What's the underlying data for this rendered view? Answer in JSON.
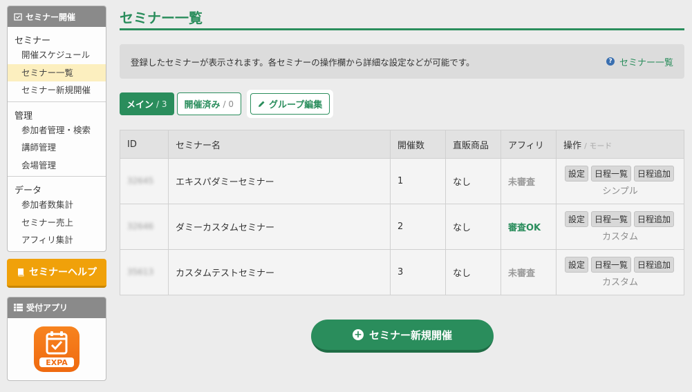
{
  "sidebar": {
    "header": "セミナー開催",
    "sections": [
      {
        "title": "セミナー",
        "items": [
          "開催スケジュール",
          "セミナー一覧",
          "セミナー新規開催"
        ]
      },
      {
        "title": "管理",
        "items": [
          "参加者管理・検索",
          "講師管理",
          "会場管理"
        ]
      },
      {
        "title": "データ",
        "items": [
          "参加者数集計",
          "セミナー売上",
          "アフィリ集計"
        ]
      }
    ],
    "help_label": "セミナーヘルプ",
    "app_header": "受付アプリ",
    "app_name": "EXPA"
  },
  "main": {
    "title": "セミナー一覧",
    "info_text": "登録したセミナーが表示されます。各セミナーの操作欄から詳細な設定などが可能です。",
    "info_link": "セミナー一覧",
    "tabs": [
      {
        "label": "メイン",
        "count": "/ 3"
      },
      {
        "label": "開催済み",
        "count": "/ 0"
      },
      {
        "label": "グループ編集",
        "count": ""
      }
    ],
    "table": {
      "headers": [
        "ID",
        "セミナー名",
        "開催数",
        "直販商品",
        "アフィリ",
        "操作"
      ],
      "ops_header_sub": "/ モード",
      "op_buttons": [
        "設定",
        "日程一覧",
        "日程追加"
      ],
      "rows": [
        {
          "id": "32645",
          "name": "エキスパダミーセミナー",
          "count": "1",
          "direct": "なし",
          "affiliate": "未審査",
          "mode": "シンプル"
        },
        {
          "id": "32646",
          "name": "ダミーカスタムセミナー",
          "count": "2",
          "direct": "なし",
          "affiliate": "審査OK",
          "mode": "カスタム"
        },
        {
          "id": "35613",
          "name": "カスタムテストセミナー",
          "count": "3",
          "direct": "なし",
          "affiliate": "未審査",
          "mode": "カスタム"
        }
      ]
    },
    "new_button": "セミナー新規開催"
  },
  "colors": {
    "accent": "#2a8d5c",
    "help": "#f0a10a",
    "highlight": "#fcefbf"
  }
}
